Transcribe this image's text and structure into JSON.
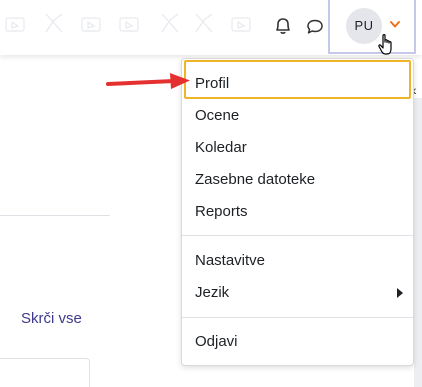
{
  "navbar": {
    "avatar_initials": "PU",
    "icons": [
      "bell-icon",
      "chat-bubble-icon",
      "chevron-down-icon"
    ],
    "chevron_color": "#e8731c"
  },
  "background": {
    "hide_all_link": "Skrči vse",
    "link_color": "#3f3a8a"
  },
  "user_menu": {
    "items": [
      {
        "label": "Profil"
      },
      {
        "label": "Ocene"
      },
      {
        "label": "Koledar"
      },
      {
        "label": "Zasebne datoteke"
      },
      {
        "label": "Reports"
      },
      {
        "label": "Nastavitve"
      },
      {
        "label": "Jezik",
        "has_submenu": true
      },
      {
        "label": "Odjavi"
      }
    ]
  },
  "annotation": {
    "highlight_color": "#f0b42a",
    "arrow_color": "#e53030",
    "highlighted_item": "Profil"
  }
}
